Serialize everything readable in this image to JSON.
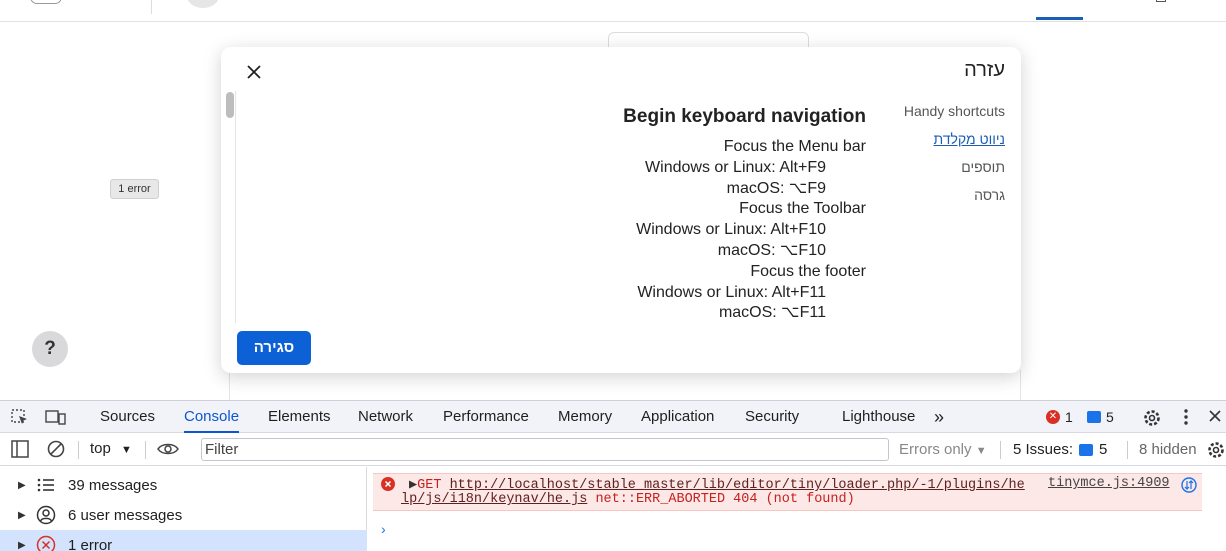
{
  "background": {
    "error_badge": "1 error",
    "help_button": "?"
  },
  "dialog": {
    "title": "עזרה",
    "close_button": "סגירה",
    "nav": [
      {
        "label": "Handy shortcuts",
        "active": false
      },
      {
        "label": "ניווט מקלדת",
        "active": true
      },
      {
        "label": "תוספים",
        "active": false
      },
      {
        "label": "גרסה",
        "active": false
      }
    ],
    "content": {
      "heading": "Begin keyboard navigation",
      "lines": [
        {
          "text": "Focus the Menu bar",
          "sub": false
        },
        {
          "text": "Windows or Linux: Alt+F9",
          "sub": true
        },
        {
          "text": "macOS: ⌥F9",
          "sub": true
        },
        {
          "text": "Focus the Toolbar",
          "sub": false
        },
        {
          "text": "Windows or Linux: Alt+F10",
          "sub": true
        },
        {
          "text": "macOS: ⌥F10",
          "sub": true
        },
        {
          "text": "Focus the footer",
          "sub": false
        },
        {
          "text": "Windows or Linux: Alt+F11",
          "sub": true
        },
        {
          "text": "macOS: ⌥F11",
          "sub": true
        }
      ]
    }
  },
  "devtools": {
    "tabs": [
      {
        "label": "Sources",
        "active": false
      },
      {
        "label": "Console",
        "active": true
      },
      {
        "label": "Elements",
        "active": false
      },
      {
        "label": "Network",
        "active": false
      },
      {
        "label": "Performance",
        "active": false
      },
      {
        "label": "Memory",
        "active": false
      },
      {
        "label": "Application",
        "active": false
      },
      {
        "label": "Security",
        "active": false
      },
      {
        "label": "Lighthouse",
        "active": false
      }
    ],
    "more_tabs": "»",
    "error_count": "1",
    "message_count": "5",
    "toolbar": {
      "context": "top",
      "filter_placeholder": "Filter",
      "levels": "Errors only",
      "issues_label": "5 Issues:",
      "issues_count": "5",
      "hidden": "8 hidden"
    },
    "sidebar": [
      {
        "label": "39 messages",
        "icon": "list-icon",
        "selected": false
      },
      {
        "label": "6 user messages",
        "icon": "user-icon",
        "selected": false
      },
      {
        "label": "1 error",
        "icon": "error-icon",
        "selected": true
      }
    ],
    "log": {
      "method": "GET",
      "url_part1": "http://localhost/stable_master/lib/editor/tiny/loader.php/-1/plugins/he",
      "url_part2": "lp/js/i18n/keynav/he.js",
      "error_text": "net::ERR_ABORTED 404 (not found)",
      "source": "tinymce.js:4909",
      "prompt": "›"
    },
    "colors": {
      "accent": "#0b57d0",
      "error": "#d93025",
      "error_bg": "#fce8e6"
    }
  }
}
